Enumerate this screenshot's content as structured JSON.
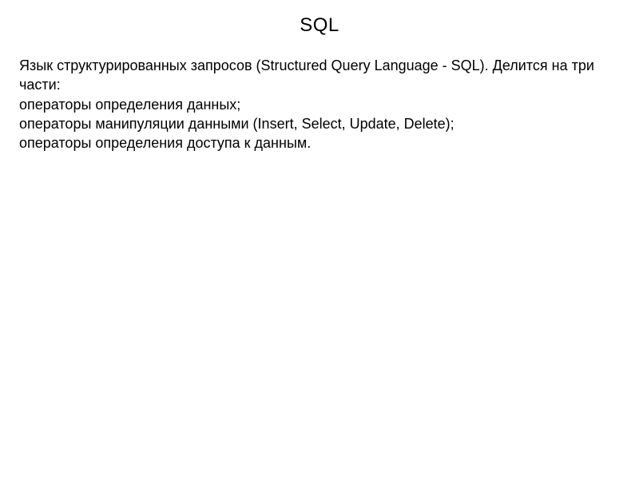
{
  "slide": {
    "title": "SQL",
    "intro": "Язык структурированных запросов (Structured Query Language - SQL). Делится на три части:",
    "items": [
      "операторы определения данных;",
      "операторы манипуляции данными (Insert, Select, Update, Delete);",
      "операторы определения доступа к данным."
    ]
  }
}
